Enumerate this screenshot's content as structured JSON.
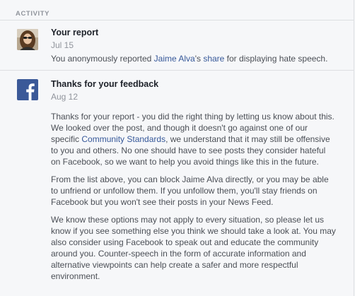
{
  "activity": {
    "header": "ACTIVITY"
  },
  "report_item": {
    "title": "Your report",
    "date": "Jul 15",
    "text_prefix": "You anonymously reported ",
    "name_link": "Jaime Alva",
    "text_mid": "'s ",
    "share_link": "share",
    "text_suffix": " for displaying hate speech."
  },
  "feedback_item": {
    "title": "Thanks for your feedback",
    "date": "Aug 12",
    "p1_a": "Thanks for your report - you did the right thing by letting us know about this. We looked over the post, and though it doesn't go against one of our specific ",
    "p1_link": "Community Standards",
    "p1_b": ", we understand that it may still be offensive to you and others. No one should have to see posts they consider hateful on Facebook, so we want to help you avoid things like this in the future.",
    "p2": "From the list above, you can block Jaime Alva directly, or you may be able to unfriend or unfollow them. If you unfollow them, you'll stay friends on Facebook but you won't see their posts in your News Feed.",
    "p3": "We know these options may not apply to every situation, so please let us know if you see something else you think we should take a look at. You may also consider using Facebook to speak out and educate the community around you. Counter-speech in the form of accurate information and alternative viewpoints can help create a safer and more respectful environment."
  },
  "colors": {
    "link": "#365899",
    "facebook_blue": "#3b5998",
    "meta_gray": "#90949c"
  },
  "icons": {
    "report_avatar": "user-avatar",
    "feedback_logo": "facebook-logo-icon"
  }
}
